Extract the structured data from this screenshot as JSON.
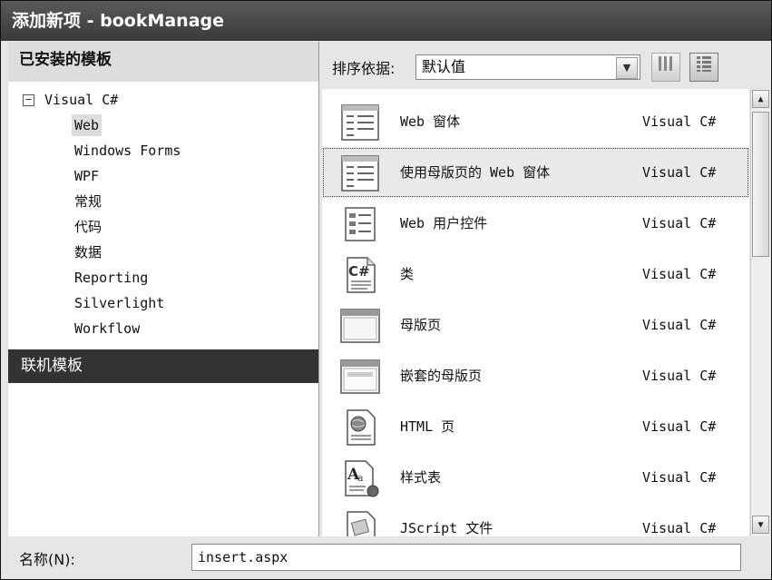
{
  "window": {
    "title": "添加新项 - bookManage"
  },
  "left_panel": {
    "installed_header": "已安装的模板",
    "root": {
      "expander": "−",
      "label": "Visual C#"
    },
    "items": [
      {
        "label": "Web",
        "selected": true
      },
      {
        "label": "Windows Forms"
      },
      {
        "label": "WPF"
      },
      {
        "label": "常规"
      },
      {
        "label": "代码"
      },
      {
        "label": "数据"
      },
      {
        "label": "Reporting"
      },
      {
        "label": "Silverlight"
      },
      {
        "label": "Workflow"
      }
    ],
    "online_header": "联机模板"
  },
  "sort": {
    "label": "排序依据:",
    "value": "默认值"
  },
  "templates": [
    {
      "name": "Web 窗体",
      "lang": "Visual C#",
      "icon": "web-form-icon"
    },
    {
      "name": "使用母版页的 Web 窗体",
      "lang": "Visual C#",
      "icon": "web-form-master-icon",
      "selected": true
    },
    {
      "name": "Web 用户控件",
      "lang": "Visual C#",
      "icon": "user-control-icon"
    },
    {
      "name": "类",
      "lang": "Visual C#",
      "icon": "class-icon"
    },
    {
      "name": "母版页",
      "lang": "Visual C#",
      "icon": "master-page-icon"
    },
    {
      "name": "嵌套的母版页",
      "lang": "Visual C#",
      "icon": "nested-master-page-icon"
    },
    {
      "name": "HTML 页",
      "lang": "Visual C#",
      "icon": "html-page-icon"
    },
    {
      "name": "样式表",
      "lang": "Visual C#",
      "icon": "stylesheet-icon"
    },
    {
      "name": "JScript 文件",
      "lang": "Visual C#",
      "icon": "jscript-file-icon"
    }
  ],
  "bottom": {
    "name_label": "名称(N):",
    "name_value": "insert.aspx"
  }
}
